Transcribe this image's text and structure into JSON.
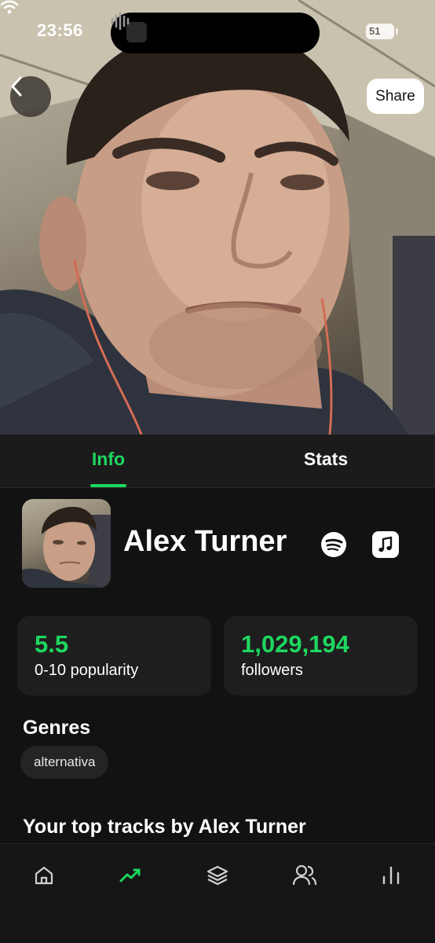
{
  "status_bar": {
    "time": "23:56",
    "battery": "51"
  },
  "header": {
    "back_icon": "chevron-left-icon",
    "share_label": "Share"
  },
  "tabs": [
    {
      "label": "Info",
      "active": true
    },
    {
      "label": "Stats",
      "active": false
    }
  ],
  "artist": {
    "name": "Alex Turner",
    "links": [
      {
        "icon": "spotify-icon"
      },
      {
        "icon": "apple-music-icon"
      }
    ]
  },
  "stats": {
    "popularity": {
      "value": "5.5",
      "label": "0-10 popularity"
    },
    "followers": {
      "value": "1,029,194",
      "label": "followers"
    }
  },
  "genres": {
    "title": "Genres",
    "items": [
      "alternativa"
    ]
  },
  "top_tracks": {
    "title": "Your top tracks by Alex Turner"
  },
  "bottom_nav": [
    {
      "icon": "home-icon",
      "active": false
    },
    {
      "icon": "trending-icon",
      "active": true
    },
    {
      "icon": "layers-icon",
      "active": false
    },
    {
      "icon": "friends-icon",
      "active": false
    },
    {
      "icon": "bar-chart-icon",
      "active": false
    }
  ],
  "colors": {
    "accent": "#1ed760",
    "background": "#121212",
    "card": "#1e1e1e"
  }
}
